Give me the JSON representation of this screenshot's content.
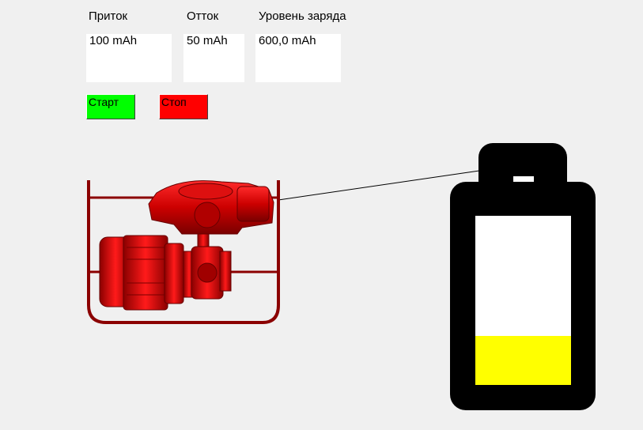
{
  "labels": {
    "inflow": "Приток",
    "outflow": "Отток",
    "charge_level": "Уровень заряда"
  },
  "fields": {
    "inflow_value": "100 mAh",
    "outflow_value": "50 mAh",
    "charge_value": "600,0 mAh"
  },
  "buttons": {
    "start_label": "Старт",
    "stop_label": "Стоп"
  },
  "colors": {
    "start_button": "#00ff00",
    "stop_button": "#ff0000",
    "battery_body": "#000000",
    "battery_empty": "#ffffff",
    "battery_fill": "#ffff00",
    "generator": "#cc0000"
  },
  "battery": {
    "fill_fraction": 0.29
  },
  "icons": {
    "generator": "generator-icon",
    "battery": "battery-icon"
  }
}
